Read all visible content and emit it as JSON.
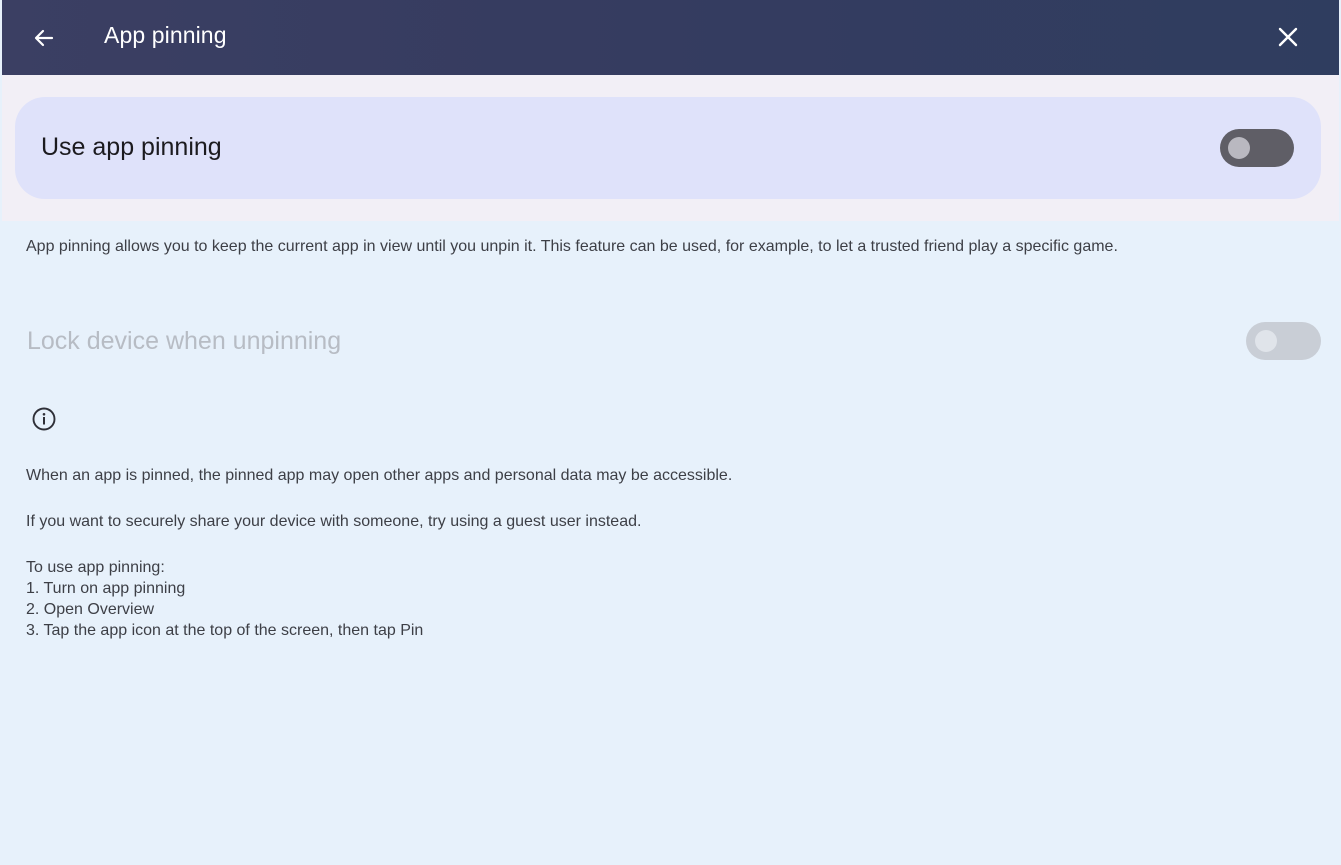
{
  "appbar": {
    "title": "App pinning",
    "back_icon": "back-arrow-icon",
    "close_icon": "close-icon"
  },
  "main_switch": {
    "label": "Use app pinning",
    "state": "off"
  },
  "description": "App pinning allows you to keep the current app in view until you unpin it. This feature can be used, for example, to let a trusted friend play a specific game.",
  "lock_switch": {
    "label": "Lock device when unpinning",
    "state": "off",
    "enabled": false
  },
  "info": {
    "icon": "info-icon",
    "warning": "When an app is pinned, the pinned app may open other apps and personal data may be accessible.",
    "guest_tip": "If you want to securely share your device with someone, try using a guest user instead.",
    "steps": "To use app pinning:\n1. Turn on app pinning\n2. Open Overview\n3. Tap the app icon at the top of the screen, then tap Pin"
  },
  "colors": {
    "appbar": "#363c60",
    "card": "#dfe2fa",
    "background": "#e7f1fb"
  }
}
